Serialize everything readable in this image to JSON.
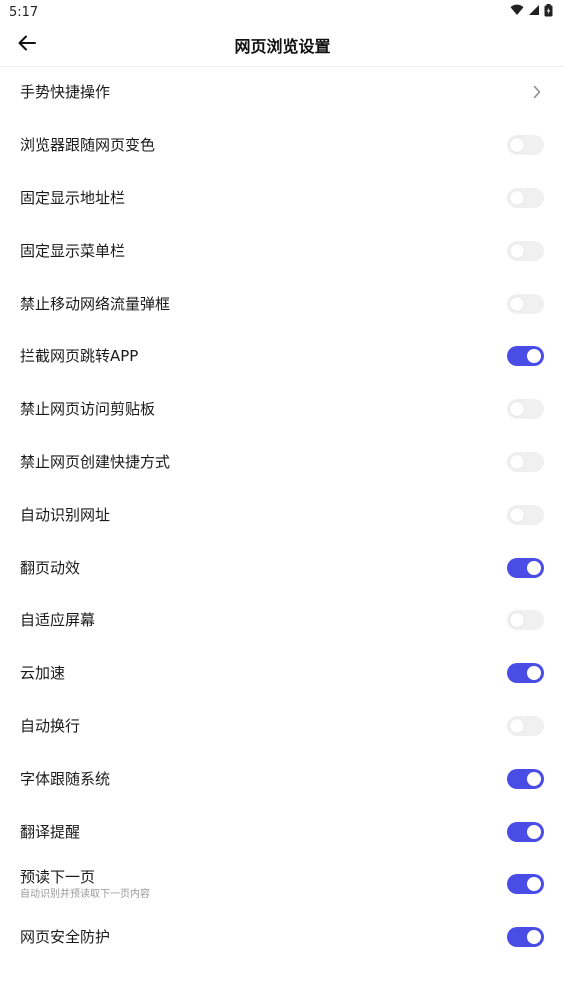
{
  "status_bar": {
    "time": "5:17",
    "icons": [
      "wifi-icon",
      "signal-icon",
      "battery-icon"
    ]
  },
  "header": {
    "title": "网页浏览设置",
    "back_icon": "arrow-left-icon"
  },
  "colors": {
    "accent": "#4a4ce6",
    "toggle_off": "#f0f0f0"
  },
  "settings": [
    {
      "label": "手势快捷操作",
      "type": "link"
    },
    {
      "label": "浏览器跟随网页变色",
      "type": "toggle",
      "on": false
    },
    {
      "label": "固定显示地址栏",
      "type": "toggle",
      "on": false
    },
    {
      "label": "固定显示菜单栏",
      "type": "toggle",
      "on": false
    },
    {
      "label": "禁止移动网络流量弹框",
      "type": "toggle",
      "on": false
    },
    {
      "label": "拦截网页跳转APP",
      "type": "toggle",
      "on": true
    },
    {
      "label": "禁止网页访问剪贴板",
      "type": "toggle",
      "on": false
    },
    {
      "label": "禁止网页创建快捷方式",
      "type": "toggle",
      "on": false
    },
    {
      "label": "自动识别网址",
      "type": "toggle",
      "on": false
    },
    {
      "label": "翻页动效",
      "type": "toggle",
      "on": true
    },
    {
      "label": "自适应屏幕",
      "type": "toggle",
      "on": false
    },
    {
      "label": "云加速",
      "type": "toggle",
      "on": true
    },
    {
      "label": "自动换行",
      "type": "toggle",
      "on": false
    },
    {
      "label": "字体跟随系统",
      "type": "toggle",
      "on": true
    },
    {
      "label": "翻译提醒",
      "type": "toggle",
      "on": true
    },
    {
      "label": "预读下一页",
      "sub": "自动识别并预读取下一页内容",
      "type": "toggle",
      "on": true
    },
    {
      "label": "网页安全防护",
      "type": "toggle",
      "on": true
    }
  ]
}
